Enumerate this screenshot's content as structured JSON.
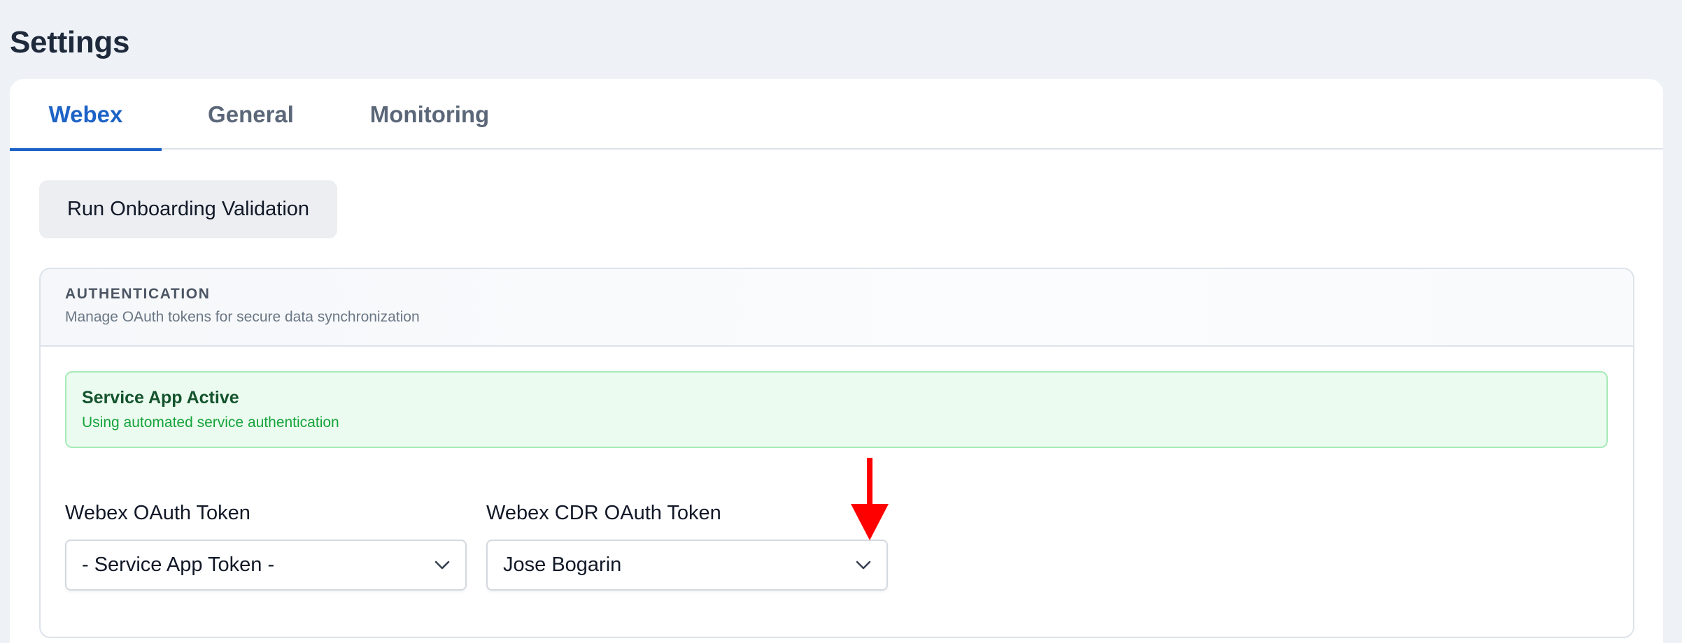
{
  "page": {
    "title": "Settings"
  },
  "tabs": [
    {
      "label": "Webex",
      "active": true
    },
    {
      "label": "General",
      "active": false
    },
    {
      "label": "Monitoring",
      "active": false
    }
  ],
  "actions": {
    "run_validation_label": "Run Onboarding Validation"
  },
  "authentication": {
    "title": "AUTHENTICATION",
    "subtitle": "Manage OAuth tokens for secure data synchronization",
    "alert": {
      "title": "Service App Active",
      "text": "Using automated service authentication"
    },
    "fields": {
      "oauth_token": {
        "label": "Webex OAuth Token",
        "value": "- Service App Token -"
      },
      "cdr_oauth_token": {
        "label": "Webex CDR OAuth Token",
        "value": "Jose Bogarin"
      }
    }
  },
  "colors": {
    "accent": "#1d63c6",
    "alert_bg": "#ebfbef",
    "alert_border": "#a7eab8",
    "annotation_arrow": "#ff0000"
  },
  "icons": {
    "select_chevron": "chevron-down-icon",
    "annotation": "red-down-arrow"
  }
}
